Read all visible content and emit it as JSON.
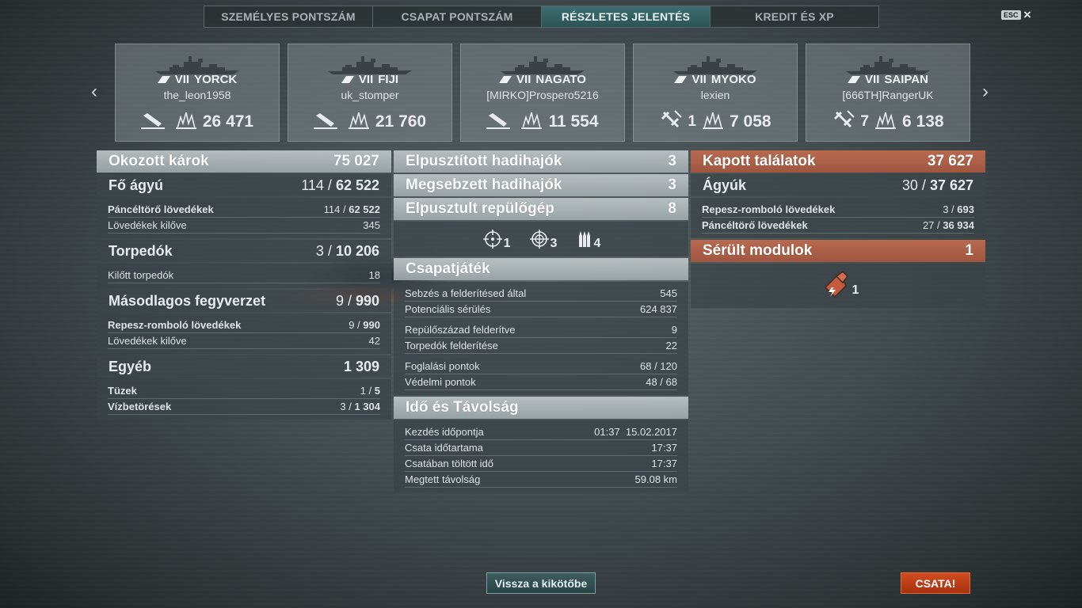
{
  "tabs": [
    {
      "label": "SZEMÉLYES PONTSZÁM"
    },
    {
      "label": "CSAPAT PONTSZÁM"
    },
    {
      "label": "RÉSZLETES JELENTÉS"
    },
    {
      "label": "KREDIT ÉS XP"
    }
  ],
  "esc_label": "ESC",
  "close_icon": "×",
  "nav": {
    "prev": "‹",
    "next": "›"
  },
  "ships": [
    {
      "tier": "VII",
      "name": "YORCK",
      "player": "the_leon1958",
      "icon": "sunk-ship-icon",
      "count": "",
      "damage": "26 471"
    },
    {
      "tier": "VII",
      "name": "FIJI",
      "player": "uk_stomper",
      "icon": "sunk-ship-icon",
      "count": "",
      "damage": "21 760"
    },
    {
      "tier": "VII",
      "name": "NAGATO",
      "player": "[MIRKO]Prospero5216",
      "icon": "sunk-ship-icon",
      "count": "",
      "damage": "11 554"
    },
    {
      "tier": "VII",
      "name": "MYOKO",
      "player": "lexien",
      "icon": "shot-down-plane-icon",
      "count": "1",
      "damage": "7 058"
    },
    {
      "tier": "VII",
      "name": "SAIPAN",
      "player": "[666TH]RangerUK",
      "icon": "shot-down-plane-icon",
      "count": "7",
      "damage": "6 138"
    }
  ],
  "left": {
    "okozott": {
      "label": "Okozott károk",
      "value": "75 027"
    },
    "fo_agyu": {
      "label": "Fő ágyú",
      "a": "114 / ",
      "b": "62 522"
    },
    "fo_rows": [
      {
        "k": "Páncéltörő lövedékek",
        "a": "114 / ",
        "b": "62 522",
        "bold": true
      },
      {
        "k": "Lövedékek kilőve",
        "a": "345",
        "b": "",
        "bold": false
      }
    ],
    "torpedok": {
      "label": "Torpedók",
      "a": "3 / ",
      "b": "10 206"
    },
    "torp_rows": [
      {
        "k": "Kilőtt torpedók",
        "a": "18",
        "b": ""
      }
    ],
    "masodlagos": {
      "label": "Másodlagos fegyverzet",
      "a": "9 / ",
      "b": "990"
    },
    "mas_rows": [
      {
        "k": "Repesz-romboló lövedékek",
        "a": "9 / ",
        "b": "990",
        "bold": true
      },
      {
        "k": "Lövedékek kilőve",
        "a": "42",
        "b": "",
        "bold": false
      }
    ],
    "egyeb": {
      "label": "Egyéb",
      "value": "1 309"
    },
    "egyeb_rows": [
      {
        "k": "Tüzek",
        "a": "1 / ",
        "b": "5"
      },
      {
        "k": "Vízbetörések",
        "a": "3 / ",
        "b": "1 304"
      }
    ]
  },
  "middle": {
    "elpusztitott": {
      "label": "Elpusztított hadihajók",
      "value": "3"
    },
    "megsebzett": {
      "label": "Megsebzett hadihajók",
      "value": "3"
    },
    "repulo": {
      "label": "Elpusztult repülőgép",
      "value": "8"
    },
    "ribbons": [
      {
        "icon": "crosshair-icon",
        "value": "1"
      },
      {
        "icon": "citadel-icon",
        "value": "3"
      },
      {
        "icon": "shells-icon",
        "value": "4"
      }
    ],
    "csapat": {
      "label": "Csapatjáték"
    },
    "csapat_rows": [
      [
        {
          "k": "Sebzés a felderítésed által",
          "v": "545"
        },
        {
          "k": "Potenciális sérülés",
          "v": "624 837"
        }
      ],
      [
        {
          "k": "Repülőszázad felderítve",
          "v": "9"
        },
        {
          "k": "Torpedók felderítése",
          "v": "22"
        }
      ],
      [
        {
          "k": "Foglalási pontok",
          "v": "68 / 120"
        },
        {
          "k": "Védelmi pontok",
          "v": "48 / 68"
        }
      ]
    ],
    "ido": {
      "label": "Idő és Távolság"
    },
    "ido_rows": [
      {
        "k": "Kezdés időpontja",
        "v": "01:37  15.02.2017"
      },
      {
        "k": "Csata időtartama",
        "v": "17:37"
      },
      {
        "k": "Csatában töltött idő",
        "v": "17:37"
      },
      {
        "k": "Megtett távolság",
        "v": "59.08 km"
      }
    ]
  },
  "right": {
    "kapott": {
      "label": "Kapott találatok",
      "value": "37 627"
    },
    "agyuk": {
      "label": "Ágyúk",
      "a": "30 / ",
      "b": "37 627"
    },
    "agyuk_rows": [
      {
        "k": "Repesz-romboló lövedékek",
        "a": "3 / ",
        "b": "693"
      },
      {
        "k": "Páncéltörő lövedékek",
        "a": "27 / ",
        "b": "36 934"
      }
    ],
    "serult": {
      "label": "Sérült modulok",
      "value": "1"
    },
    "module": {
      "icon": "damaged-module-icon",
      "value": "1"
    }
  },
  "buttons": {
    "back": "Vissza a kikötőbe",
    "battle": "CSATA!"
  }
}
